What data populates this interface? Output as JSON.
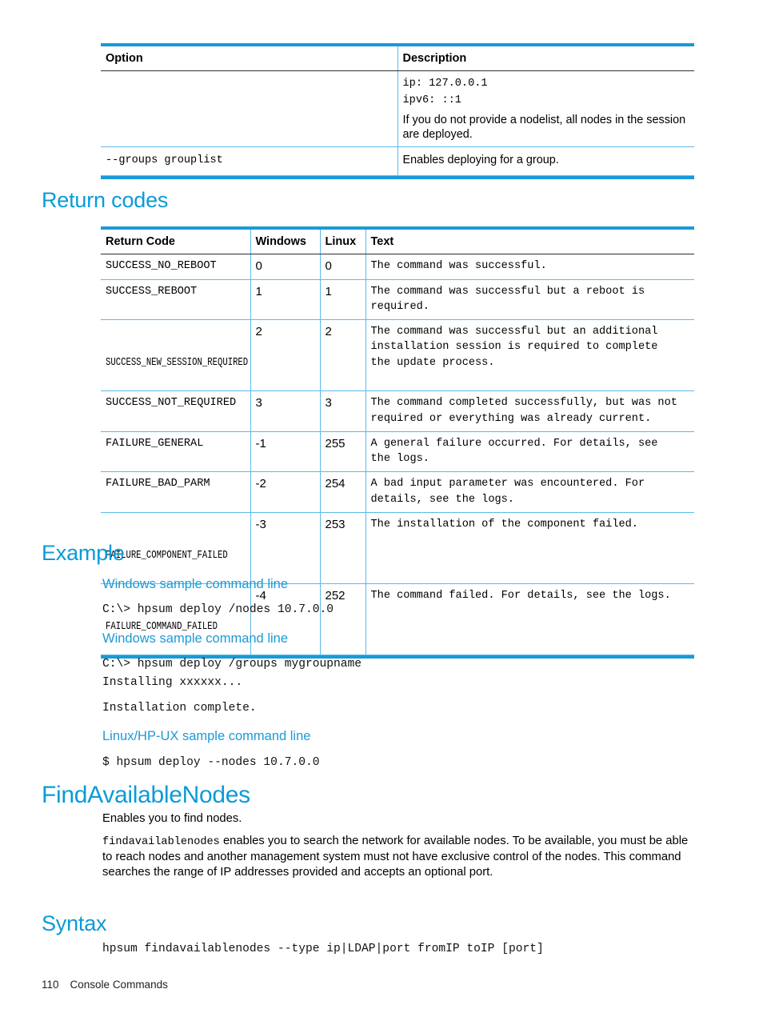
{
  "document": {
    "footer": {
      "page_number": "110",
      "chapter": "Console Commands"
    }
  },
  "options_table": {
    "name": "deploy-options-table",
    "headers": [
      "Option",
      "Description"
    ],
    "rows": [
      {
        "option": "",
        "description_mono": [
          "ip: 127.0.0.1",
          "ipv6: ::1"
        ],
        "description_text": "If you do not provide a nodelist, all nodes in the session are deployed."
      },
      {
        "option": "--groups grouplist",
        "description_mono": [],
        "description_text": "Enables deploying for a group."
      }
    ]
  },
  "return_codes": {
    "heading": "Return codes",
    "headers": [
      "Return Code",
      "Windows",
      "Linux",
      "Text"
    ],
    "rows": [
      {
        "code": "SUCCESS_NO_REBOOT",
        "windows": "0",
        "linux": "0",
        "text": "The command was successful.",
        "condensed": false
      },
      {
        "code": "SUCCESS_REBOOT",
        "windows": "1",
        "linux": "1",
        "text": "The command was successful but a reboot is\nrequired.",
        "condensed": false
      },
      {
        "code": "SUCCESS_NEW_SESSION_REQUIRED",
        "windows": "2",
        "linux": "2",
        "text": "The command was successful but an additional\ninstallation session is required to complete\nthe update process.",
        "condensed": true
      },
      {
        "code": "SUCCESS_NOT_REQUIRED",
        "windows": "3",
        "linux": "3",
        "text": "The command completed successfully, but was not\nrequired or everything was already current.",
        "condensed": false
      },
      {
        "code": "FAILURE_GENERAL",
        "windows": "-1",
        "linux": "255",
        "text": "A general failure occurred. For details, see\nthe logs.",
        "condensed": false
      },
      {
        "code": "FAILURE_BAD_PARM",
        "windows": "-2",
        "linux": "254",
        "text": "A bad input parameter was encountered. For\ndetails, see the logs.",
        "condensed": false
      },
      {
        "code": "FAILURE_COMPONENT_FAILED",
        "windows": "-3",
        "linux": "253",
        "text": "The installation of the component failed.",
        "condensed": true
      },
      {
        "code": "FAILURE_COMMAND_FAILED",
        "windows": "-4",
        "linux": "252",
        "text": "The command failed. For details, see the logs.",
        "condensed": true
      }
    ]
  },
  "example": {
    "heading": "Example",
    "blocks": [
      {
        "title": "Windows sample command line",
        "lines": [
          "C:\\> hpsum deploy /nodes 10.7.0.0"
        ]
      },
      {
        "title": "Windows sample command line",
        "lines": [
          "C:\\> hpsum deploy /groups mygroupname",
          "Installing xxxxxx...",
          "Installation complete."
        ]
      },
      {
        "title": "Linux/HP-UX sample command line",
        "lines": [
          "$ hpsum deploy --nodes 10.7.0.0"
        ]
      }
    ]
  },
  "find_available_nodes": {
    "heading": "FindAvailableNodes",
    "intro": "Enables you to find nodes.",
    "paragraph_command": "findavailablenodes",
    "paragraph_rest": " enables you to search the network for available nodes. To be available, you must be able to reach nodes and another management system must not have exclusive control of the nodes. This command searches the range of IP addresses provided and accepts an optional port.",
    "syntax_heading": "Syntax",
    "syntax_line": "hpsum findavailablenodes --type ip|LDAP|port fromIP toIP [port]"
  },
  "colors": {
    "heading_blue": "#0b9bd7",
    "subheading_blue": "#1c9ad6",
    "table_border_blue": "#5cb9e8",
    "table_rule_blue": "#1a9ad8",
    "text_black": "#000000"
  }
}
